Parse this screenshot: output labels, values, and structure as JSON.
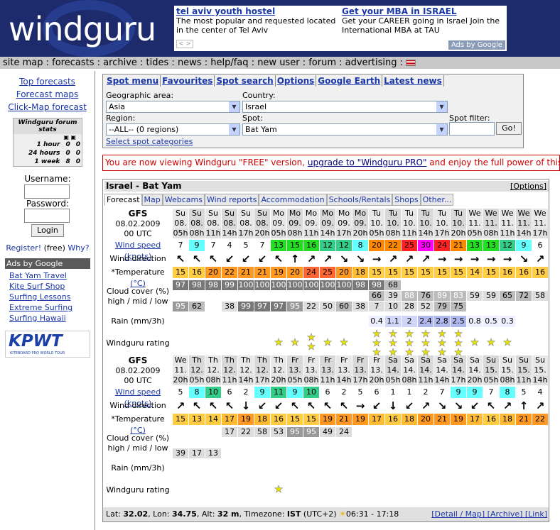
{
  "header": {
    "logo": "windguru",
    "ads": [
      {
        "title": "tel aviv youth hostel",
        "text": "The most popular and requested located in the center of Tel Aviv"
      },
      {
        "title": "Get your MBA in ISRAEL",
        "text": "Get your CAREER going in Israel Join the International MBA at TAU"
      }
    ],
    "ads_by": "Ads by Google"
  },
  "nav": [
    "site map",
    "forecasts",
    "archive",
    "tides",
    "news",
    "help/faq",
    "new user",
    "forum",
    "advertising"
  ],
  "sidebar": {
    "links": [
      "Top forecasts",
      "Forecast maps",
      "Click-Map forecast"
    ],
    "stats_title": "Windguru forum stats",
    "stats": [
      [
        "1 hour",
        "0",
        "0"
      ],
      [
        "24 hours",
        "0",
        "0"
      ],
      [
        "1 week",
        "8",
        "0"
      ]
    ],
    "username": "Username:",
    "password": "Password:",
    "login": "Login",
    "register": "Register!",
    "free": "(free)",
    "why": "Why?",
    "ads_title": "Ads by Google",
    "ads": [
      "Bat Yam Travel",
      "Kite Surf Shop",
      "Surfing Lessons",
      "Extreme Surfing",
      "Surfing Hawaii"
    ],
    "kpwt": "KPWT",
    "kpwt_sub": "KITEBOARD PRO WORLD TOUR"
  },
  "spot": {
    "tabs": [
      "Spot menu",
      "Favourites",
      "Spot search",
      "Options",
      "Google Earth",
      "Latest news"
    ],
    "geo_label": "Geographic area:",
    "geo": "Asia",
    "country_label": "Country:",
    "country": "Israel",
    "region_label": "Region:",
    "region": "--ALL-- (0 regions)",
    "spot_label": "Spot:",
    "spot": "Bat Yam",
    "filter_label": "Spot filter:",
    "go": "Go!",
    "categories": "Select spot categories"
  },
  "notice": {
    "pre": "You are now viewing Windguru \"FREE\" version, ",
    "link": "upgrade to \"Windguru PRO\"",
    "post": " and enjoy the full power of this websit"
  },
  "forecast": {
    "title": "Israel - Bat Yam",
    "options": "[Options]",
    "tabs": [
      "Forecast",
      "Map",
      "Webcams",
      "Wind reports",
      "Accommodation",
      "Schools/Rentals",
      "Shops",
      "Other..."
    ],
    "model": "GFS",
    "date": "08.02.2009",
    "utc": "00 UTC",
    "labels": {
      "speed": "Wind speed",
      "knots": "(knots)",
      "dir": "Wind direction",
      "temp": "*Temperature",
      "tunit": "(°C)",
      "cloud1": "Cloud cover (%)",
      "cloud2": "high / mid / low",
      "rain": "Rain (mm/3h)",
      "rating": "Windguru rating"
    },
    "block1": {
      "day": [
        "Su",
        "Su",
        "Su",
        "Su",
        "Su",
        "Su",
        "Mo",
        "Mo",
        "Mo",
        "Mo",
        "Mo",
        "Mo",
        "Tu",
        "Tu",
        "Tu",
        "Tu",
        "Tu",
        "Tu",
        "We",
        "We",
        "We",
        "We",
        "We"
      ],
      "date": [
        "08.",
        "08.",
        "08.",
        "08.",
        "08.",
        "08.",
        "09.",
        "09.",
        "09.",
        "09.",
        "09.",
        "09.",
        "10.",
        "10.",
        "10.",
        "10.",
        "10.",
        "10.",
        "11.",
        "11.",
        "11.",
        "11.",
        "11."
      ],
      "hour": [
        "05h",
        "08h",
        "11h",
        "14h",
        "17h",
        "20h",
        "05h",
        "08h",
        "11h",
        "14h",
        "17h",
        "20h",
        "05h",
        "08h",
        "11h",
        "14h",
        "17h",
        "20h",
        "05h",
        "08h",
        "11h",
        "14h",
        "17h"
      ],
      "speed": [
        "7",
        "9",
        "7",
        "4",
        "5",
        "7",
        "13",
        "15",
        "16",
        "12",
        "12",
        "8",
        "20",
        "22",
        "25",
        "30",
        "24",
        "21",
        "13",
        "13",
        "12",
        "9",
        "6"
      ],
      "dir": [
        "↖",
        "↖",
        "↖",
        "↙",
        "↙",
        "↙",
        "↖",
        "↑",
        "↗",
        "↗",
        "↘",
        "↘",
        "→",
        "↗",
        "↗",
        "↗",
        "→",
        "→",
        "→",
        "→",
        "→",
        "↘",
        "↗"
      ],
      "temp": [
        "15",
        "16",
        "20",
        "22",
        "21",
        "21",
        "19",
        "20",
        "24",
        "25",
        "20",
        "18",
        "15",
        "15",
        "15",
        "15",
        "15",
        "15",
        "14",
        "15",
        "16",
        "16",
        "16"
      ],
      "high": [
        "97",
        "98",
        "98",
        "99",
        "100",
        "100",
        "100",
        "100",
        "100",
        "100",
        "100",
        "98",
        "98",
        "68",
        "",
        "",
        "",
        "",
        "",
        "",
        "",
        "",
        ""
      ],
      "mid": [
        "",
        "",
        "",
        "",
        "",
        "",
        "",
        "",
        "",
        "",
        "",
        "",
        "66",
        "39",
        "88",
        "76",
        "89",
        "83",
        "59",
        "59",
        "65",
        "72",
        "58"
      ],
      "low": [
        "95",
        "62",
        "",
        "38",
        "99",
        "97",
        "97",
        "95",
        "22",
        "50",
        "60",
        "38",
        "7",
        "10",
        "28",
        "52",
        "79",
        "75",
        "",
        "",
        "",
        "",
        ""
      ],
      "rain": [
        "",
        "",
        "",
        "",
        "",
        "",
        "",
        "",
        "",
        "",
        "",
        "",
        "0.4",
        "1.1",
        "2",
        "2.4",
        "2.8",
        "2.5",
        "0.8",
        "0.5",
        "0.3",
        "",
        ""
      ],
      "rating": [
        0,
        0,
        0,
        0,
        0,
        0,
        1,
        1,
        2,
        1,
        1,
        0,
        3,
        3,
        3,
        3,
        3,
        3,
        1,
        1,
        1,
        0,
        0
      ]
    },
    "block2": {
      "day": [
        "We",
        "Th",
        "Th",
        "Th",
        "Th",
        "Th",
        "Th",
        "Fr",
        "Fr",
        "Fr",
        "Fr",
        "Fr",
        "Fr",
        "Sa",
        "Sa",
        "Sa",
        "Sa",
        "Sa",
        "Sa",
        "Su",
        "Su",
        "Su",
        "Su"
      ],
      "date": [
        "11.",
        "12.",
        "12.",
        "12.",
        "12.",
        "12.",
        "12.",
        "13.",
        "13.",
        "13.",
        "13.",
        "13.",
        "13.",
        "14.",
        "14.",
        "14.",
        "14.",
        "14.",
        "14.",
        "15.",
        "15.",
        "15.",
        "15."
      ],
      "hour": [
        "20h",
        "05h",
        "08h",
        "11h",
        "14h",
        "17h",
        "20h",
        "05h",
        "08h",
        "11h",
        "14h",
        "17h",
        "20h",
        "05h",
        "08h",
        "11h",
        "14h",
        "17h",
        "20h",
        "05h",
        "08h",
        "11h",
        "14h"
      ],
      "speed": [
        "5",
        "8",
        "10",
        "6",
        "2",
        "9",
        "11",
        "9",
        "10",
        "6",
        "2",
        "5",
        "6",
        "1",
        "1",
        "2",
        "7",
        "9",
        "9",
        "7",
        "8",
        "5",
        "4"
      ],
      "dir": [
        "↗",
        "↖",
        "↖",
        "↖",
        "↓",
        "↙",
        "↙",
        "↖",
        "↖",
        "↖",
        "↖",
        "→",
        "↙",
        "↓",
        "↙",
        "↗",
        "↘",
        "↘",
        "↙",
        "↖",
        "↗",
        "↑",
        "↗"
      ],
      "temp": [
        "15",
        "13",
        "14",
        "17",
        "19",
        "18",
        "16",
        "15",
        "15",
        "19",
        "21",
        "19",
        "17",
        "16",
        "18",
        "20",
        "21",
        "19",
        "17",
        "16",
        "18",
        "21",
        "22"
      ],
      "high": [
        "",
        "",
        "",
        "17",
        "22",
        "58",
        "53",
        "95",
        "95",
        "49",
        "24",
        "",
        "",
        "",
        "",
        "",
        "",
        "",
        "",
        "",
        "",
        "",
        ""
      ],
      "low": [
        "39",
        "17",
        "13",
        "",
        "",
        "",
        "",
        "",
        "",
        "",
        "",
        "",
        "",
        "",
        "",
        "",
        "",
        "",
        "",
        "",
        "",
        "",
        ""
      ],
      "rating": [
        0,
        0,
        0,
        0,
        0,
        0,
        1,
        0,
        0,
        0,
        0,
        0,
        0,
        0,
        0,
        0,
        0,
        0,
        0,
        0,
        0,
        0,
        0
      ]
    },
    "footer": {
      "lat_l": "Lat: ",
      "lat": "32.02",
      "lon_l": ", Lon: ",
      "lon": "34.75",
      "alt_l": ", Alt: ",
      "alt": "32 m",
      "tz_l": ", Timezone: ",
      "tz": "IST",
      "tz2": " (UTC+2)",
      "sun": "06:31 - 17:18",
      "links": "[Detail / Map] [Archive] [Link]"
    }
  }
}
